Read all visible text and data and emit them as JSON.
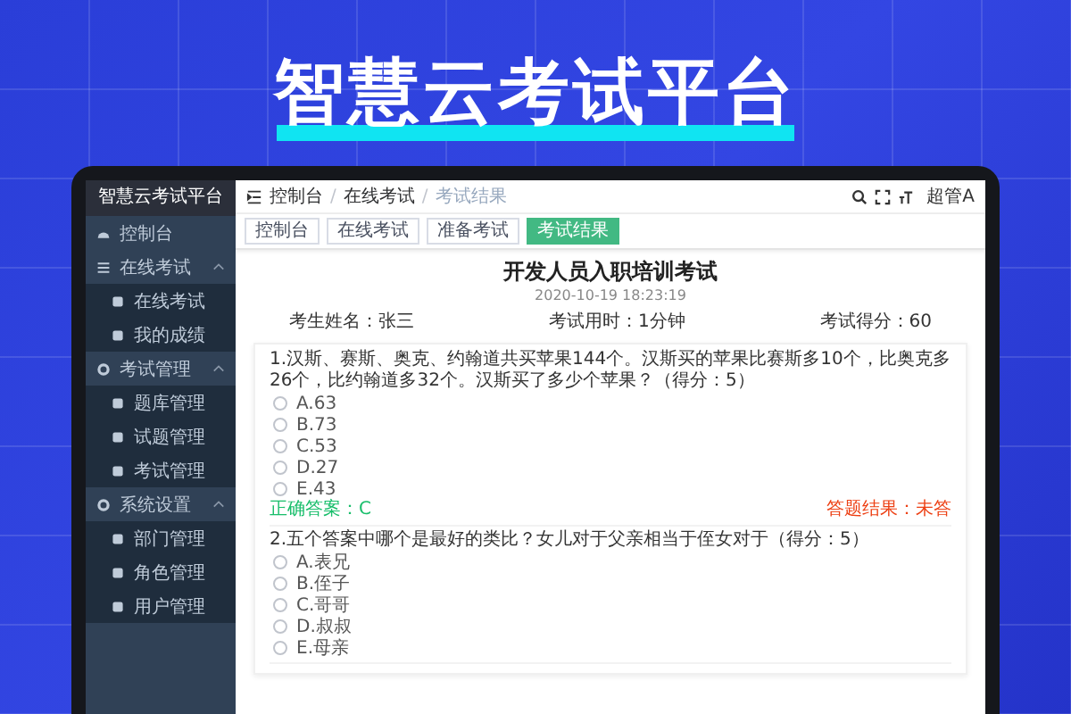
{
  "banner": {
    "title": "智慧云考试平台"
  },
  "sidebar": {
    "title": "智慧云考试平台",
    "items": [
      {
        "label": "控制台"
      },
      {
        "label": "在线考试",
        "expanded": true,
        "children": [
          {
            "label": "在线考试"
          },
          {
            "label": "我的成绩"
          }
        ]
      },
      {
        "label": "考试管理",
        "expanded": true,
        "children": [
          {
            "label": "题库管理"
          },
          {
            "label": "试题管理"
          },
          {
            "label": "考试管理"
          }
        ]
      },
      {
        "label": "系统设置",
        "expanded": true,
        "children": [
          {
            "label": "部门管理"
          },
          {
            "label": "角色管理"
          },
          {
            "label": "用户管理"
          }
        ]
      }
    ]
  },
  "header": {
    "breadcrumb": [
      "控制台",
      "在线考试",
      "考试结果"
    ],
    "separator": "/",
    "user": "超管A"
  },
  "tabs": [
    {
      "label": "控制台",
      "selected": false
    },
    {
      "label": "在线考试",
      "selected": false
    },
    {
      "label": "准备考试",
      "selected": false
    },
    {
      "label": "考试结果",
      "selected": true
    }
  ],
  "exam": {
    "title": "开发人员入职培训考试",
    "date": "2020-10-19 18:23:19",
    "info": [
      "考生姓名：张三",
      "考试用时：1分钟",
      "考试得分：60"
    ],
    "questions": [
      {
        "text": "1.汉斯、赛斯、奥克、约翰道共买苹果144个。汉斯买的苹果比赛斯多10个，比奥克多26个，比约翰道多32个。汉斯买了多少个苹果？（得分：5）",
        "options": [
          {
            "label": "A.63",
            "selected": false
          },
          {
            "label": "B.73",
            "selected": false
          },
          {
            "label": "C.53",
            "selected": false
          },
          {
            "label": "D.27",
            "selected": false
          },
          {
            "label": "E.43",
            "selected": false
          }
        ],
        "answer": "正确答案：C",
        "result": "答题结果：未答"
      },
      {
        "text": "2.五个答案中哪个是最好的类比？女儿对于父亲相当于侄女对于（得分：5）",
        "options": [
          {
            "label": "A.表兄",
            "selected": false
          },
          {
            "label": "B.侄子",
            "selected": false
          },
          {
            "label": "C.哥哥",
            "selected": false
          },
          {
            "label": "D.叔叔",
            "selected": false
          },
          {
            "label": "E.母亲",
            "selected": false
          }
        ]
      }
    ]
  }
}
